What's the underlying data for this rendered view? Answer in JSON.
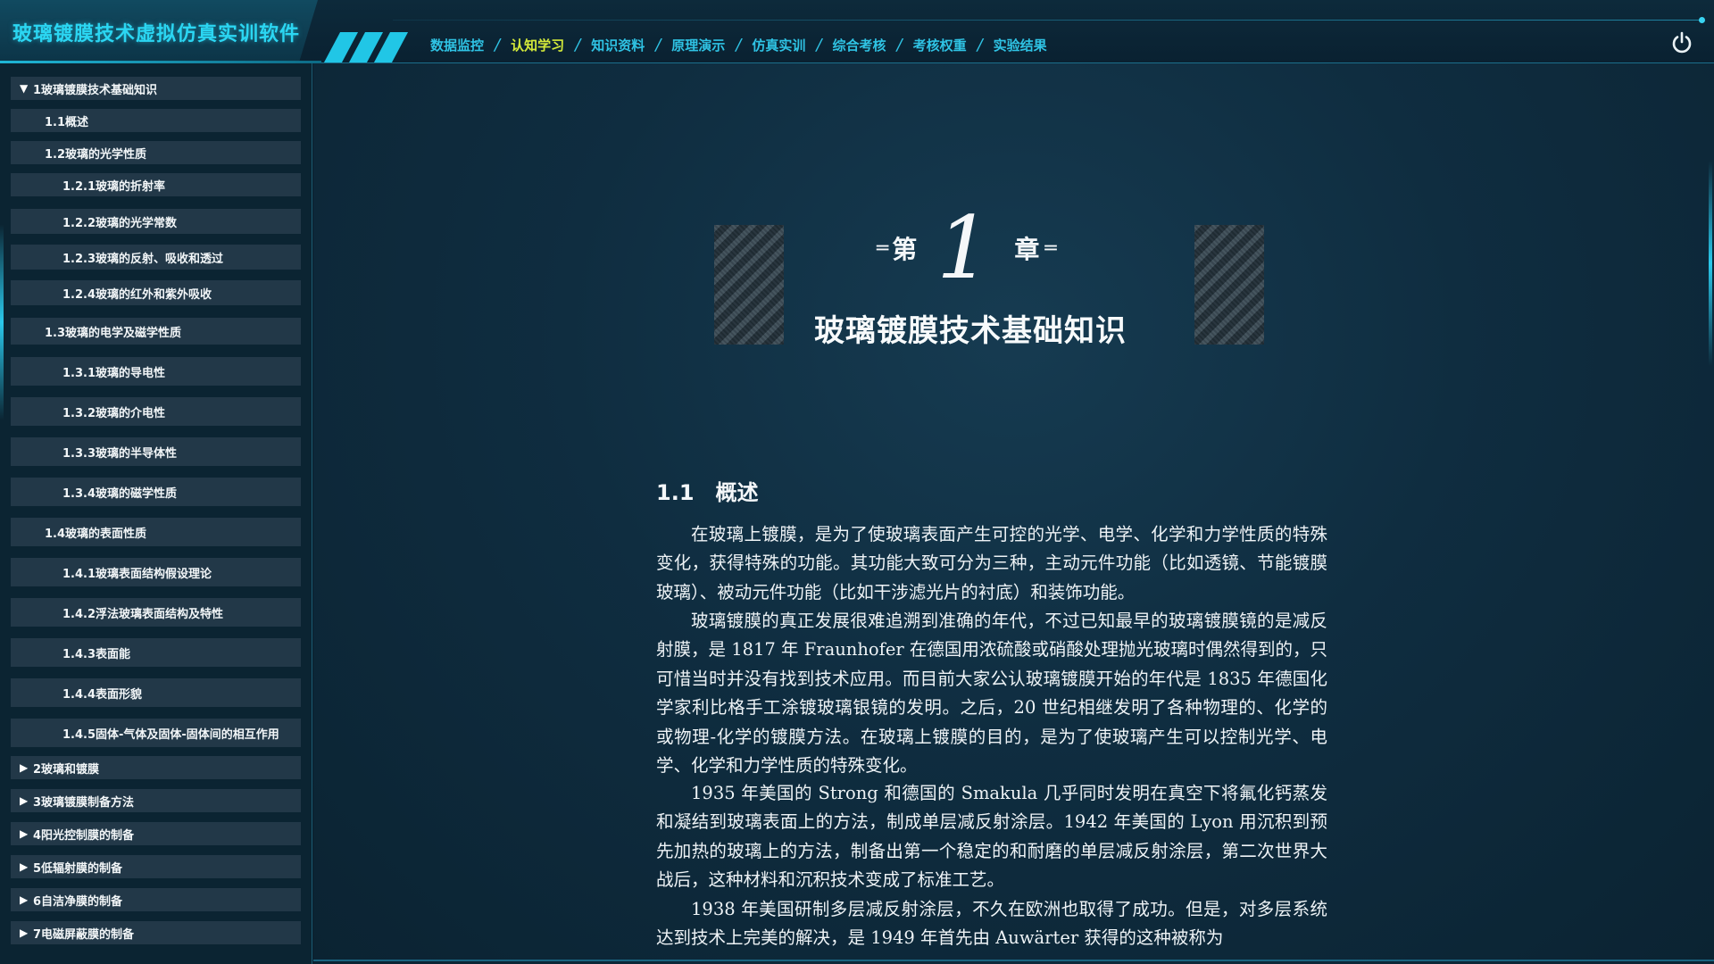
{
  "app": {
    "title": "玻璃镀膜技术虚拟仿真实训软件"
  },
  "nav": {
    "items": [
      {
        "label": "数据监控",
        "active": false
      },
      {
        "label": "认知学习",
        "active": true
      },
      {
        "label": "知识资料",
        "active": false
      },
      {
        "label": "原理演示",
        "active": false
      },
      {
        "label": "仿真实训",
        "active": false
      },
      {
        "label": "综合考核",
        "active": false
      },
      {
        "label": "考核权重",
        "active": false
      },
      {
        "label": "实验结果",
        "active": false
      }
    ],
    "separator": "/",
    "active_color": "#d4ea3a",
    "color": "#2fc3e4",
    "power_icon": "power-icon"
  },
  "sidebar": {
    "items": [
      {
        "label": "1玻璃镀膜技术基础知识",
        "level": 1,
        "expanded": true
      },
      {
        "label": "1.1概述",
        "level": 2
      },
      {
        "label": "1.2玻璃的光学性质",
        "level": 2
      },
      {
        "label": "1.2.1玻璃的折射率",
        "level": 3
      },
      {
        "label": "1.2.2玻璃的光学常数",
        "level": 3
      },
      {
        "label": "1.2.3玻璃的反射、吸收和透过",
        "level": 3
      },
      {
        "label": "1.2.4玻璃的红外和紫外吸收",
        "level": 3
      },
      {
        "label": "1.3玻璃的电学及磁学性质",
        "level": 2
      },
      {
        "label": "1.3.1玻璃的导电性",
        "level": 3
      },
      {
        "label": "1.3.2玻璃的介电性",
        "level": 3
      },
      {
        "label": "1.3.3玻璃的半导体性",
        "level": 3
      },
      {
        "label": "1.3.4玻璃的磁学性质",
        "level": 3
      },
      {
        "label": "1.4玻璃的表面性质",
        "level": 2
      },
      {
        "label": "1.4.1玻璃表面结构假设理论",
        "level": 3
      },
      {
        "label": "1.4.2浮法玻璃表面结构及特性",
        "level": 3
      },
      {
        "label": "1.4.3表面能",
        "level": 3
      },
      {
        "label": "1.4.4表面形貌",
        "level": 3
      },
      {
        "label": "1.4.5固体-气体及固体-固体间的相互作用",
        "level": 3
      },
      {
        "label": "2玻璃和镀膜",
        "level": 1,
        "expanded": false
      },
      {
        "label": "3玻璃镀膜制备方法",
        "level": 1,
        "expanded": false
      },
      {
        "label": "4阳光控制膜的制备",
        "level": 1,
        "expanded": false
      },
      {
        "label": "5低辐射膜的制备",
        "level": 1,
        "expanded": false
      },
      {
        "label": "6自洁净膜的制备",
        "level": 1,
        "expanded": false
      },
      {
        "label": "7电磁屏蔽膜的制备",
        "level": 1,
        "expanded": false
      }
    ],
    "expanded_icon": "▼",
    "collapsed_icon": "▶"
  },
  "document": {
    "chapter_prefix": "第",
    "chapter_number": "1",
    "chapter_suffix": "章",
    "chapter_title": "玻璃镀膜技术基础知识",
    "section_number": "1.1",
    "section_title": "概述",
    "paragraphs": [
      "在玻璃上镀膜，是为了使玻璃表面产生可控的光学、电学、化学和力学性质的特殊变化，获得特殊的功能。其功能大致可分为三种，主动元件功能（比如透镜、节能镀膜玻璃）、被动元件功能（比如干涉滤光片的衬底）和装饰功能。",
      "玻璃镀膜的真正发展很难追溯到准确的年代，不过已知最早的玻璃镀膜镜的是减反射膜，是 1817 年 Fraunhofer 在德国用浓硫酸或硝酸处理抛光玻璃时偶然得到的，只可惜当时并没有找到技术应用。而目前大家公认玻璃镀膜开始的年代是 1835 年德国化学家利比格手工涂镀玻璃银镜的发明。之后，20 世纪相继发明了各种物理的、化学的或物理-化学的镀膜方法。在玻璃上镀膜的目的，是为了使玻璃产生可以控制光学、电学、化学和力学性质的特殊变化。",
      "1935 年美国的 Strong 和德国的 Smakula 几乎同时发明在真空下将氟化钙蒸发和凝结到玻璃表面上的方法，制成单层减反射涂层。1942 年美国的 Lyon 用沉积到预先加热的玻璃上的方法，制备出第一个稳定的和耐磨的单层减反射涂层，第二次世界大战后，这种材料和沉积技术变成了标准工艺。",
      "1938 年美国研制多层减反射涂层，不久在欧洲也取得了成功。但是，对多层系统达到技术上完美的解决，是 1949 年首先由 Auwärter 获得的这种被称为"
    ]
  }
}
